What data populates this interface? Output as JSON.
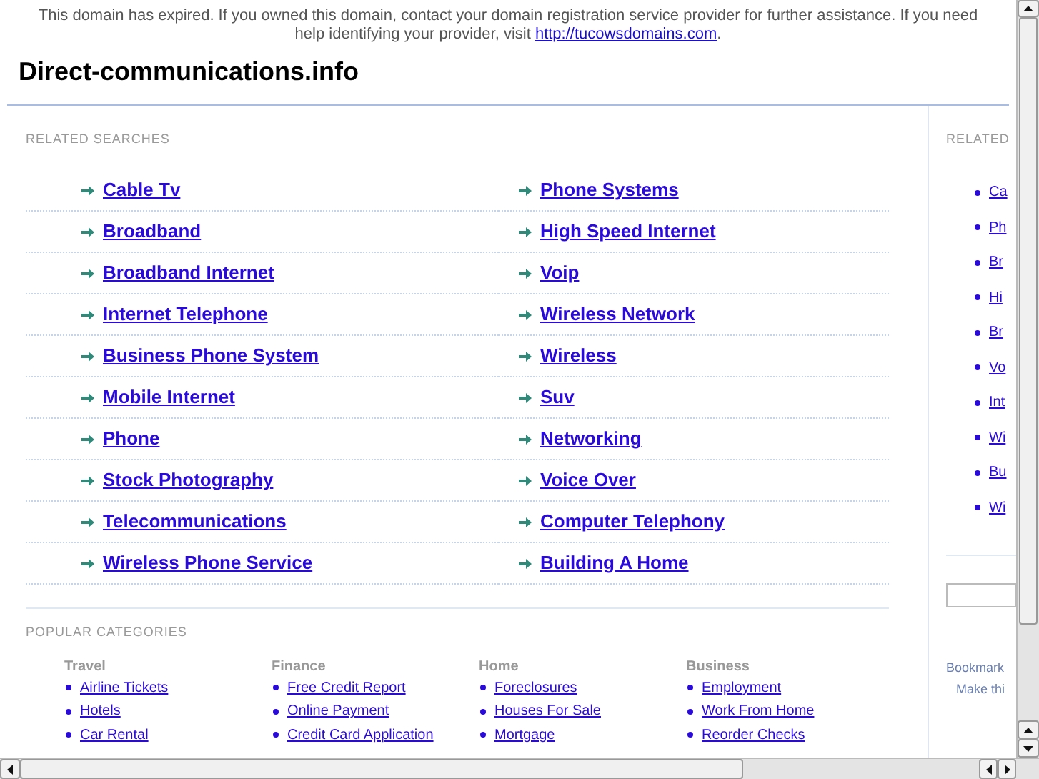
{
  "banner": {
    "text": "This domain has expired. If you owned this domain, contact your domain registration service provider for further assistance. If you need help identifying your provider, visit",
    "link": "http://tucowsdomains.com",
    "after": "."
  },
  "site_title": "Direct-communications.info",
  "related_searches": {
    "heading": "RELATED SEARCHES",
    "left": [
      "Cable Tv",
      "Broadband",
      "Broadband Internet",
      "Internet Telephone",
      "Business Phone System",
      "Mobile Internet",
      "Phone",
      "Stock Photography",
      "Telecommunications",
      "Wireless Phone Service"
    ],
    "right": [
      "Phone Systems",
      "High Speed Internet",
      "Voip",
      "Wireless Network",
      "Wireless",
      "Suv",
      "Networking",
      "Voice Over",
      "Computer Telephony",
      "Building A Home"
    ]
  },
  "popular_categories": {
    "heading": "POPULAR CATEGORIES",
    "columns": [
      {
        "title": "Travel",
        "links": [
          "Airline Tickets",
          "Hotels",
          "Car Rental"
        ]
      },
      {
        "title": "Finance",
        "links": [
          "Free Credit Report",
          "Online Payment",
          "Credit Card Application"
        ]
      },
      {
        "title": "Home",
        "links": [
          "Foreclosures",
          "Houses For Sale",
          "Mortgage"
        ]
      },
      {
        "title": "Business",
        "links": [
          "Employment",
          "Work From Home",
          "Reorder Checks"
        ]
      }
    ]
  },
  "sidebar": {
    "heading": "RELATED",
    "links": [
      "Ca",
      "Ph",
      "Br",
      "Hi",
      "Br",
      "Vo",
      "Int",
      "Wi",
      "Bu",
      "Wi"
    ],
    "bookmark": "Bookmark",
    "make": "Make thi"
  }
}
